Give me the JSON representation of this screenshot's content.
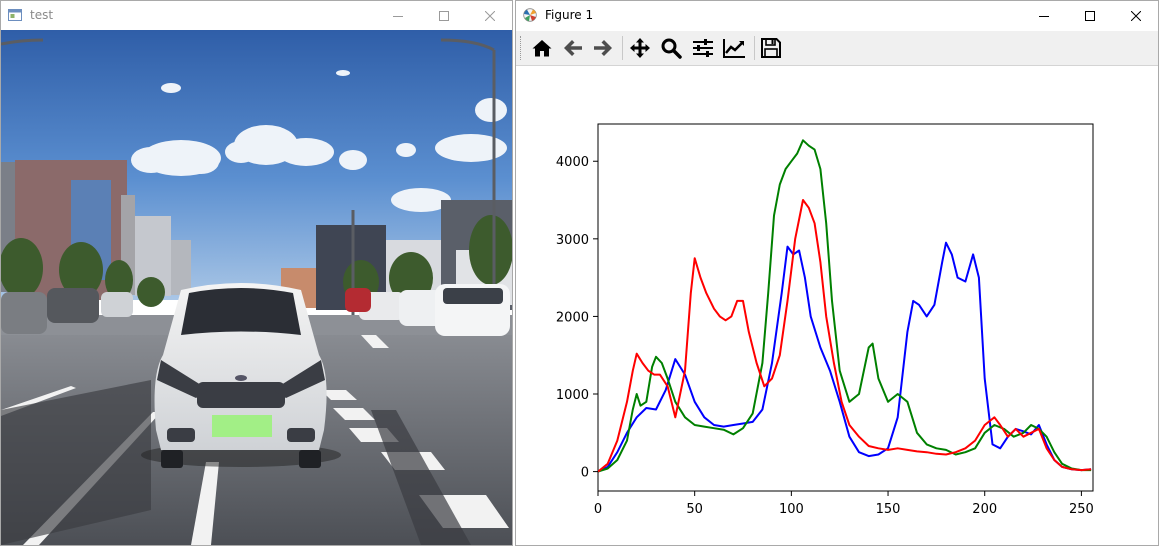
{
  "left_window": {
    "title": "test",
    "icon": "opencv-window-icon"
  },
  "right_window": {
    "title": "Figure 1",
    "icon": "matplotlib-icon",
    "toolbar": [
      {
        "name": "home-icon",
        "label": "Home"
      },
      {
        "name": "back-arrow-icon",
        "label": "Back"
      },
      {
        "name": "forward-arrow-icon",
        "label": "Forward"
      },
      {
        "name": "pan-icon",
        "label": "Pan"
      },
      {
        "name": "zoom-icon",
        "label": "Zoom"
      },
      {
        "name": "subplots-icon",
        "label": "Configure subplots"
      },
      {
        "name": "edit-axis-icon",
        "label": "Edit axis"
      },
      {
        "name": "save-icon",
        "label": "Save"
      }
    ]
  },
  "window_controls": [
    "minimize-icon",
    "maximize-icon",
    "close-icon"
  ],
  "chart_data": {
    "type": "line",
    "title": "",
    "xlabel": "",
    "ylabel": "",
    "xlim": [
      0,
      256
    ],
    "ylim": [
      -250,
      4480
    ],
    "xticks": [
      0,
      50,
      100,
      150,
      200,
      250
    ],
    "yticks": [
      0,
      1000,
      2000,
      3000,
      4000
    ],
    "grid": false,
    "legend": "none",
    "series": [
      {
        "color": "#0000ff",
        "points": [
          [
            0,
            0
          ],
          [
            5,
            60
          ],
          [
            10,
            250
          ],
          [
            15,
            500
          ],
          [
            20,
            700
          ],
          [
            25,
            820
          ],
          [
            30,
            800
          ],
          [
            35,
            1050
          ],
          [
            40,
            1450
          ],
          [
            45,
            1250
          ],
          [
            50,
            900
          ],
          [
            55,
            700
          ],
          [
            60,
            600
          ],
          [
            65,
            580
          ],
          [
            70,
            600
          ],
          [
            75,
            620
          ],
          [
            80,
            640
          ],
          [
            85,
            800
          ],
          [
            90,
            1400
          ],
          [
            95,
            2300
          ],
          [
            98,
            2900
          ],
          [
            101,
            2800
          ],
          [
            104,
            2850
          ],
          [
            107,
            2500
          ],
          [
            110,
            2000
          ],
          [
            115,
            1600
          ],
          [
            120,
            1300
          ],
          [
            125,
            900
          ],
          [
            130,
            450
          ],
          [
            135,
            250
          ],
          [
            140,
            200
          ],
          [
            145,
            220
          ],
          [
            150,
            300
          ],
          [
            155,
            700
          ],
          [
            160,
            1800
          ],
          [
            163,
            2200
          ],
          [
            166,
            2150
          ],
          [
            170,
            2000
          ],
          [
            174,
            2150
          ],
          [
            178,
            2700
          ],
          [
            180,
            2950
          ],
          [
            183,
            2800
          ],
          [
            186,
            2500
          ],
          [
            190,
            2450
          ],
          [
            194,
            2800
          ],
          [
            197,
            2500
          ],
          [
            200,
            1200
          ],
          [
            204,
            350
          ],
          [
            208,
            300
          ],
          [
            212,
            450
          ],
          [
            216,
            550
          ],
          [
            220,
            520
          ],
          [
            224,
            480
          ],
          [
            228,
            600
          ],
          [
            232,
            350
          ],
          [
            236,
            150
          ],
          [
            240,
            60
          ],
          [
            245,
            30
          ],
          [
            250,
            20
          ],
          [
            255,
            30
          ]
        ]
      },
      {
        "color": "#008000",
        "points": [
          [
            0,
            0
          ],
          [
            5,
            40
          ],
          [
            10,
            150
          ],
          [
            15,
            400
          ],
          [
            18,
            800
          ],
          [
            20,
            1000
          ],
          [
            22,
            850
          ],
          [
            25,
            900
          ],
          [
            28,
            1350
          ],
          [
            30,
            1480
          ],
          [
            33,
            1400
          ],
          [
            36,
            1200
          ],
          [
            40,
            900
          ],
          [
            45,
            700
          ],
          [
            50,
            600
          ],
          [
            55,
            580
          ],
          [
            60,
            560
          ],
          [
            65,
            540
          ],
          [
            70,
            480
          ],
          [
            75,
            560
          ],
          [
            80,
            750
          ],
          [
            85,
            1400
          ],
          [
            88,
            2300
          ],
          [
            91,
            3300
          ],
          [
            94,
            3700
          ],
          [
            97,
            3900
          ],
          [
            100,
            4000
          ],
          [
            103,
            4100
          ],
          [
            106,
            4270
          ],
          [
            109,
            4200
          ],
          [
            112,
            4150
          ],
          [
            115,
            3900
          ],
          [
            118,
            3200
          ],
          [
            121,
            2200
          ],
          [
            125,
            1300
          ],
          [
            130,
            900
          ],
          [
            135,
            1000
          ],
          [
            140,
            1600
          ],
          [
            142,
            1650
          ],
          [
            145,
            1200
          ],
          [
            150,
            900
          ],
          [
            155,
            1000
          ],
          [
            160,
            900
          ],
          [
            165,
            500
          ],
          [
            170,
            350
          ],
          [
            175,
            300
          ],
          [
            180,
            280
          ],
          [
            185,
            220
          ],
          [
            190,
            250
          ],
          [
            195,
            300
          ],
          [
            200,
            500
          ],
          [
            205,
            600
          ],
          [
            210,
            550
          ],
          [
            215,
            450
          ],
          [
            220,
            500
          ],
          [
            224,
            600
          ],
          [
            228,
            550
          ],
          [
            232,
            450
          ],
          [
            236,
            250
          ],
          [
            240,
            100
          ],
          [
            245,
            40
          ],
          [
            250,
            20
          ],
          [
            255,
            20
          ]
        ]
      },
      {
        "color": "#ff0000",
        "points": [
          [
            0,
            0
          ],
          [
            5,
            100
          ],
          [
            10,
            400
          ],
          [
            15,
            900
          ],
          [
            18,
            1300
          ],
          [
            20,
            1520
          ],
          [
            23,
            1400
          ],
          [
            26,
            1300
          ],
          [
            29,
            1250
          ],
          [
            32,
            1250
          ],
          [
            36,
            1100
          ],
          [
            40,
            700
          ],
          [
            45,
            1300
          ],
          [
            48,
            2300
          ],
          [
            50,
            2750
          ],
          [
            53,
            2500
          ],
          [
            56,
            2300
          ],
          [
            60,
            2100
          ],
          [
            63,
            2000
          ],
          [
            66,
            1950
          ],
          [
            69,
            2000
          ],
          [
            72,
            2200
          ],
          [
            75,
            2200
          ],
          [
            78,
            1800
          ],
          [
            82,
            1400
          ],
          [
            86,
            1100
          ],
          [
            90,
            1200
          ],
          [
            94,
            1500
          ],
          [
            98,
            2200
          ],
          [
            102,
            3000
          ],
          [
            106,
            3500
          ],
          [
            109,
            3400
          ],
          [
            112,
            3200
          ],
          [
            115,
            2700
          ],
          [
            118,
            2000
          ],
          [
            122,
            1400
          ],
          [
            126,
            900
          ],
          [
            130,
            600
          ],
          [
            135,
            450
          ],
          [
            140,
            330
          ],
          [
            145,
            300
          ],
          [
            150,
            280
          ],
          [
            155,
            300
          ],
          [
            160,
            280
          ],
          [
            165,
            260
          ],
          [
            170,
            250
          ],
          [
            175,
            230
          ],
          [
            180,
            220
          ],
          [
            185,
            250
          ],
          [
            190,
            300
          ],
          [
            195,
            400
          ],
          [
            200,
            600
          ],
          [
            205,
            700
          ],
          [
            208,
            600
          ],
          [
            212,
            450
          ],
          [
            216,
            550
          ],
          [
            220,
            450
          ],
          [
            224,
            500
          ],
          [
            228,
            550
          ],
          [
            232,
            300
          ],
          [
            236,
            150
          ],
          [
            240,
            60
          ],
          [
            245,
            30
          ],
          [
            250,
            20
          ],
          [
            255,
            30
          ]
        ]
      }
    ]
  }
}
